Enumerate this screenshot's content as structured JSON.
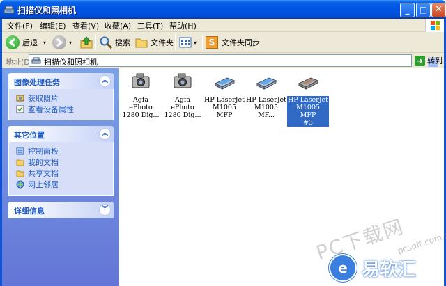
{
  "window": {
    "title": "扫描仪和照相机"
  },
  "menu": {
    "items": [
      "文件(F)",
      "编辑(E)",
      "查看(V)",
      "收藏(A)",
      "工具(T)",
      "帮助(H)"
    ]
  },
  "toolbar": {
    "back_label": "后退",
    "search_label": "搜索",
    "folders_label": "文件夹",
    "sync_label": "文件夹同步"
  },
  "address": {
    "label": "地址(D)",
    "value": "扫描仪和照相机",
    "go_label": "转到"
  },
  "taskpane": {
    "imaging": {
      "title": "图像处理任务",
      "items": [
        "获取照片",
        "查看设备属性"
      ]
    },
    "other_places": {
      "title": "其它位置",
      "items": [
        "控制面板",
        "我的文档",
        "共享文档",
        "网上邻居"
      ]
    },
    "details": {
      "title": "详细信息"
    }
  },
  "devices": [
    {
      "label": "Agfa ePhoto\n1280 Dig...",
      "icon": "camera-icon",
      "selected": false
    },
    {
      "label": "Agfa ePhoto\n1280 Dig...",
      "icon": "camera-icon",
      "selected": false
    },
    {
      "label": "HP LaserJet\nM1005 MFP",
      "icon": "scanner-icon",
      "selected": false
    },
    {
      "label": "HP LaserJet\nM1005 MF...",
      "icon": "scanner-icon",
      "selected": false
    },
    {
      "label": "HP LaserJet\nM1005 MFP\n#3",
      "icon": "scanner-icon",
      "selected": true
    }
  ],
  "watermark": {
    "url": "PC下载网",
    "domain": "pcsoft.com.cn",
    "brand": "易软汇"
  },
  "colors": {
    "titlebar": "#0054E3",
    "taskpane": "#6375D6",
    "task_link": "#215DC6",
    "selection": "#316AC5"
  }
}
